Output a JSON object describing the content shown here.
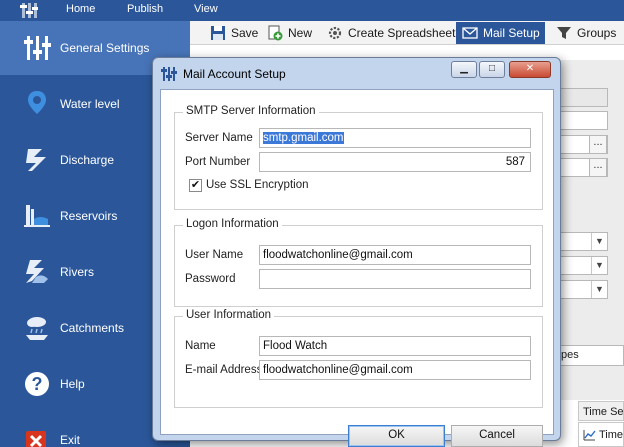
{
  "ribbon": {
    "tabs": [
      {
        "label": "Home"
      },
      {
        "label": "Publish"
      },
      {
        "label": "View"
      }
    ]
  },
  "sidebar": {
    "items": [
      {
        "label": "General Settings",
        "icon": "sliders-icon",
        "active": true
      },
      {
        "label": "Water level",
        "icon": "location-pin-icon"
      },
      {
        "label": "Discharge",
        "icon": "water-wave-icon"
      },
      {
        "label": "Reservoirs",
        "icon": "dam-icon"
      },
      {
        "label": "Rivers",
        "icon": "river-icon"
      },
      {
        "label": "Catchments",
        "icon": "rain-cloud-icon"
      },
      {
        "label": "Help",
        "icon": "help-icon"
      },
      {
        "label": "Exit",
        "icon": "exit-icon"
      }
    ]
  },
  "toolbar": {
    "save_label": "Save",
    "new_label": "New",
    "create_spreadsheet_label": "Create Spreadsheet",
    "mail_setup_label": "Mail Setup",
    "groups_label": "Groups"
  },
  "background": {
    "dots": "...",
    "types_fragment": "pes",
    "time_series_header": "Time Seri",
    "time_cell": "Time"
  },
  "dialog": {
    "title": "Mail Account Setup",
    "smtp": {
      "title": "SMTP Server Information",
      "server_name_label": "Server Name",
      "server_name_value": "smtp.gmail.com",
      "port_label": "Port Number",
      "port_value": "587",
      "ssl_label": "Use SSL Encryption",
      "ssl_checked": true
    },
    "logon": {
      "title": "Logon Information",
      "user_name_label": "User Name",
      "user_name_value": "floodwatchonline@gmail.com",
      "password_label": "Password",
      "password_value": ""
    },
    "user": {
      "title": "User Information",
      "name_label": "Name",
      "name_value": "Flood Watch",
      "email_label": "E-mail Address",
      "email_value": "floodwatchonline@gmail.com"
    },
    "ok_label": "OK",
    "cancel_label": "Cancel"
  },
  "colors": {
    "sidebar": "#2b579a",
    "sidebar_active": "#4774b8",
    "toolbar_active": "#2b579a",
    "dialog_frame": "#c3d5ec",
    "selection": "#3c78d8"
  }
}
